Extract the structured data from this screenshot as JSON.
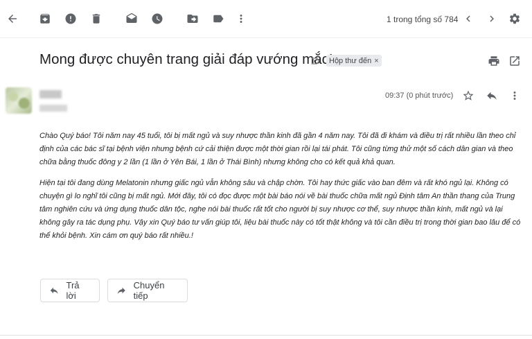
{
  "toolbar": {
    "pager_text": "1 trong tổng số 784"
  },
  "email": {
    "subject": "Mong được chuyên trang giải đáp vướng mắc!",
    "label": "Hộp thư đến",
    "label_close": "×",
    "time": "09:37 (0 phút trước)",
    "paragraphs": [
      "Chào Quý báo! Tôi năm nay 45 tuổi, tôi bị mất ngủ và suy nhược thần kinh đã gần 4 năm nay. Tôi đã đi khám và điều trị rất nhiều lần theo chỉ định của các bác sĩ tại bệnh viện nhưng bệnh cứ cải thiện được một thời gian rồi lại tái phát. Tôi cũng từng  thử một số cách dân gian và theo chữa bằng thuốc đông y 2 lần (1 lần ở Yên Bái, 1 lần ở Thái Bình) nhưng không cho có kết quả khả quan.",
      "Hiện tại tôi  đang dùng Melatonin nhưng giấc ngủ vẫn không sâu và chập chờn. Tôi hay thức giấc vào ban đêm và rất khó ngủ lại. Không có chuyện gì lo nghĩ tôi cũng bị mất ngủ. Mới đây, tôi có đọc được một bài báo nói về bài thuốc chữa mất ngủ Định tâm An thần thang của Trung tâm nghiên cứu và ứng dụng thuốc dân tộc, nghe nói bài thuốc rất tốt cho người bị suy nhược cơ thể, suy nhược thần kinh, mất ngủ và lại không gây ra tác dụng phụ. Vậy xin Quý báo tư vấn giúp tôi, liệu bài thuốc này có tốt thật không và tôi cần điều trị trong thời gian bao lâu để có thể khỏi bệnh. Xin cám ơn quý báo rất nhiều.!"
    ]
  },
  "actions": {
    "reply_label": "Trả lời",
    "forward_label": "Chuyển tiếp"
  },
  "icons": [
    "back-arrow-icon",
    "archive-icon",
    "report-spam-icon",
    "delete-icon",
    "mark-unread-icon",
    "snooze-icon",
    "move-to-icon",
    "labels-icon",
    "more-icon",
    "prev-icon",
    "next-icon",
    "settings-icon",
    "print-icon",
    "open-new-window-icon",
    "star-icon",
    "reply-icon",
    "more-vert-icon",
    "importance-icon"
  ]
}
